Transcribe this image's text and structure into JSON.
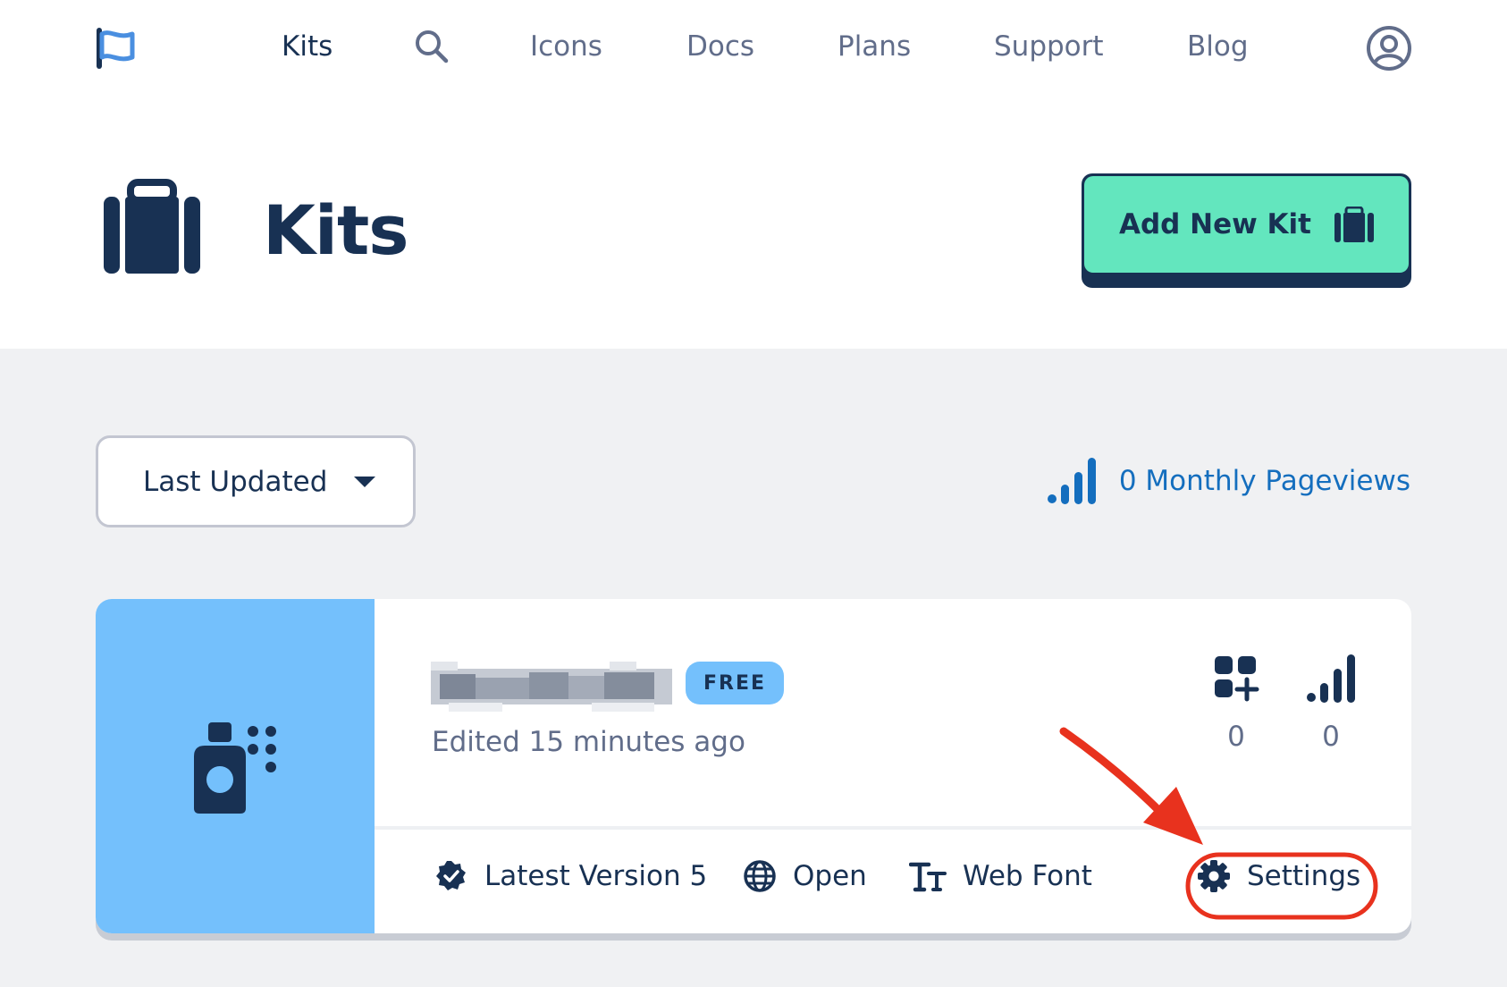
{
  "nav": {
    "logo_icon": "flag-logo-icon",
    "items": [
      {
        "label": "Kits"
      },
      {
        "label": "Icons"
      },
      {
        "label": "Docs"
      },
      {
        "label": "Plans"
      },
      {
        "label": "Support"
      },
      {
        "label": "Blog"
      }
    ],
    "search_icon": "magnifying-glass-icon",
    "account_icon": "user-circle-icon"
  },
  "page": {
    "title": "Kits",
    "title_icon": "suitcase-icon",
    "add_button_label": "Add New Kit",
    "add_button_icon": "suitcase-icon"
  },
  "toolbar": {
    "sort_label": "Last Updated",
    "pageviews_label": "0 Monthly Pageviews",
    "pageviews_icon": "signal-bars-icon"
  },
  "kit": {
    "name_redacted": true,
    "badge": "FREE",
    "edited": "Edited 15 minutes ago",
    "thumbnail_icon": "spray-bottle-icon",
    "stats": [
      {
        "icon": "grid-add-icon",
        "value": "0"
      },
      {
        "icon": "signal-bars-icon",
        "value": "0"
      }
    ],
    "actions": [
      {
        "icon": "verified-check-icon",
        "label": "Latest Version 5"
      },
      {
        "icon": "globe-icon",
        "label": "Open"
      },
      {
        "icon": "text-size-icon",
        "label": "Web Font"
      },
      {
        "icon": "gear-icon",
        "label": "Settings"
      }
    ]
  },
  "colors": {
    "brand_navy": "#183153",
    "muted_text": "#616d8a",
    "accent_green": "#63e6be",
    "thumb_blue": "#74c0fc",
    "link_blue": "#146ebe",
    "annotation_red": "#e8321e",
    "content_bg": "#f0f1f3"
  }
}
